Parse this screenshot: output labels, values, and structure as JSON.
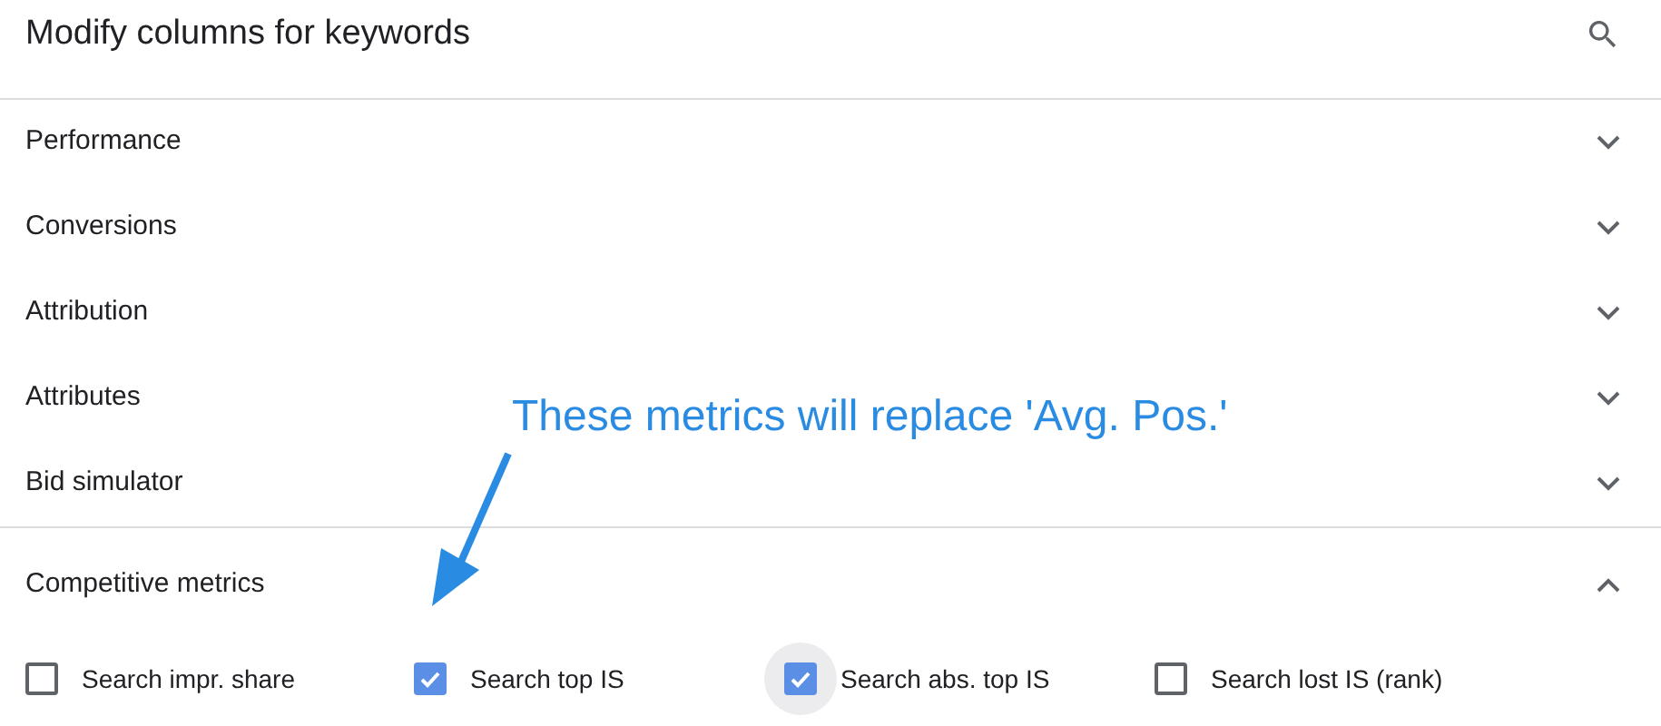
{
  "dialog": {
    "title": "Modify columns for keywords"
  },
  "sections": [
    {
      "label": "Performance",
      "expanded": false
    },
    {
      "label": "Conversions",
      "expanded": false
    },
    {
      "label": "Attribution",
      "expanded": false
    },
    {
      "label": "Attributes",
      "expanded": false
    },
    {
      "label": "Bid simulator",
      "expanded": false
    },
    {
      "label": "Competitive metrics",
      "expanded": true,
      "options": [
        {
          "label": "Search impr. share",
          "checked": false,
          "focused": false
        },
        {
          "label": "Search top IS",
          "checked": true,
          "focused": false
        },
        {
          "label": "Search abs. top IS",
          "checked": true,
          "focused": true
        },
        {
          "label": "Search lost IS (rank)",
          "checked": false,
          "focused": false
        }
      ]
    }
  ],
  "annotation": {
    "text": "These metrics will replace 'Avg. Pos.'"
  }
}
